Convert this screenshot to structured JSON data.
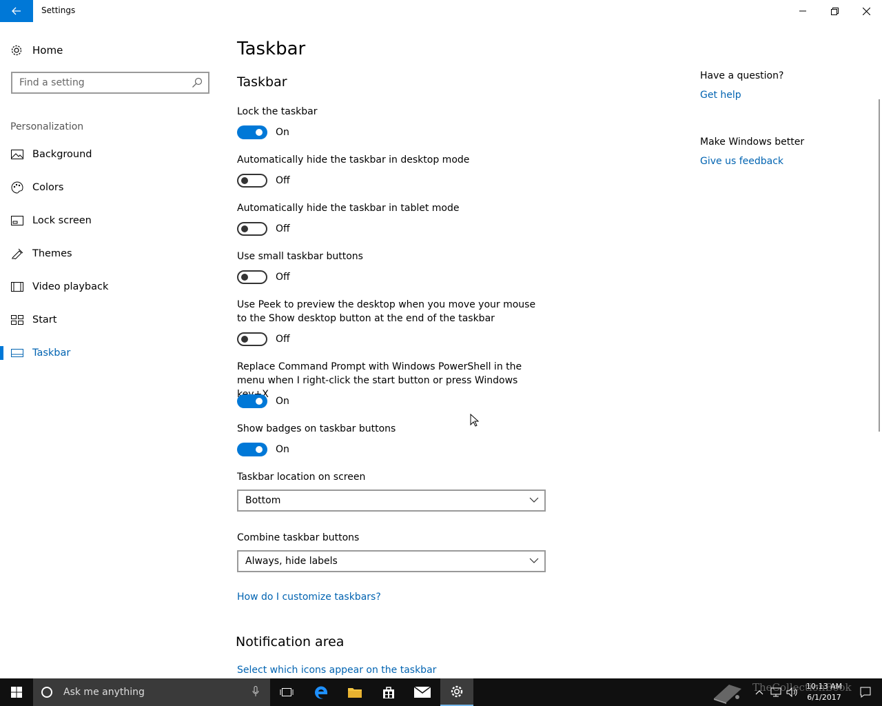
{
  "window": {
    "title": "Settings"
  },
  "sidebar": {
    "home_label": "Home",
    "search_placeholder": "Find a setting",
    "section_label": "Personalization",
    "items": [
      {
        "label": "Background",
        "icon": "image-icon"
      },
      {
        "label": "Colors",
        "icon": "palette-icon"
      },
      {
        "label": "Lock screen",
        "icon": "lock-screen-icon"
      },
      {
        "label": "Themes",
        "icon": "themes-icon"
      },
      {
        "label": "Video playback",
        "icon": "video-icon"
      },
      {
        "label": "Start",
        "icon": "start-tiles-icon"
      },
      {
        "label": "Taskbar",
        "icon": "taskbar-icon",
        "active": true
      }
    ]
  },
  "main": {
    "page_title": "Taskbar",
    "section_title": "Taskbar",
    "settings": [
      {
        "label": "Lock the taskbar",
        "state": "On"
      },
      {
        "label": "Automatically hide the taskbar in desktop mode",
        "state": "Off"
      },
      {
        "label": "Automatically hide the taskbar in tablet mode",
        "state": "Off"
      },
      {
        "label": "Use small taskbar buttons",
        "state": "Off"
      },
      {
        "label": "Use Peek to preview the desktop when you move your mouse to the Show desktop button at the end of the taskbar",
        "state": "Off"
      },
      {
        "label": "Replace Command Prompt with Windows PowerShell in the menu when I right-click the start button or press Windows key+X",
        "state": "On"
      },
      {
        "label": "Show badges on taskbar buttons",
        "state": "On"
      }
    ],
    "location": {
      "label": "Taskbar location on screen",
      "value": "Bottom"
    },
    "combine": {
      "label": "Combine taskbar buttons",
      "value": "Always, hide labels"
    },
    "customize_link": "How do I customize taskbars?",
    "notification_title": "Notification area",
    "notification_link": "Select which icons appear on the taskbar"
  },
  "help": {
    "question": "Have a question?",
    "get_help": "Get help",
    "better": "Make Windows better",
    "feedback": "Give us feedback"
  },
  "taskbar": {
    "search_text": "Ask me anything",
    "time": "10:13 AM",
    "date": "6/1/2017",
    "watermark": "TheCollectionBook"
  },
  "colors": {
    "accent": "#0078d7",
    "link": "#0063b1",
    "taskbar": "#101010"
  }
}
